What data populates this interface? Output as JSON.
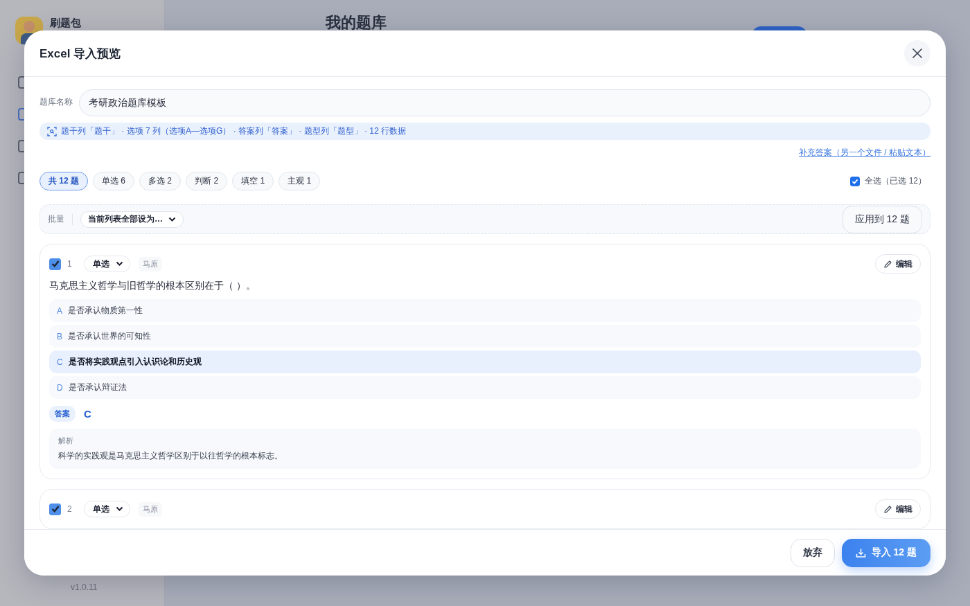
{
  "background": {
    "app_name": "刷题包",
    "page_title": "我的题库",
    "version": "v1.0.11"
  },
  "dialog": {
    "title": "Excel 导入预览",
    "bank_name": {
      "label": "题库名称",
      "value": "考研政治题库模板"
    },
    "detected": "题干列「题干」 · 选项 7 列（选项A—选项G） · 答案列「答案」 · 题型列「题型」 · 12 行数据",
    "supplement_link": "补充答案（另一个文件 / 粘贴文本）",
    "filters": [
      {
        "label": "共 12 题",
        "selected": true
      },
      {
        "label": "单选 6",
        "selected": false
      },
      {
        "label": "多选 2",
        "selected": false
      },
      {
        "label": "判断 2",
        "selected": false
      },
      {
        "label": "填空 1",
        "selected": false
      },
      {
        "label": "主观 1",
        "selected": false
      }
    ],
    "select_all": {
      "label": "全选（已选 12）",
      "checked": true
    },
    "batch": {
      "label": "批量",
      "select": "当前列表全部设为…",
      "apply": "应用到 12 题"
    },
    "questions": [
      {
        "number": "1",
        "checked": true,
        "type": "单选",
        "tag": "马原",
        "edit": "编辑",
        "stem": "马克思主义哲学与旧哲学的根本区别在于（ ）。",
        "options": [
          {
            "letter": "A",
            "text": "是否承认物质第一性",
            "selected": false
          },
          {
            "letter": "B",
            "text": "是否承认世界的可知性",
            "selected": false
          },
          {
            "letter": "C",
            "text": "是否将实践观点引入认识论和历史观",
            "selected": true
          },
          {
            "letter": "D",
            "text": "是否承认辩证法",
            "selected": false
          }
        ],
        "answer_label": "答案",
        "answer": "C",
        "analysis_label": "解析",
        "analysis": "科学的实践观是马克思主义哲学区别于以往哲学的根本标志。"
      },
      {
        "number": "2",
        "checked": true,
        "type": "单选",
        "tag": "马原",
        "edit": "编辑"
      }
    ]
  },
  "footer": {
    "cancel": "放弃",
    "import": "导入 12 题"
  }
}
